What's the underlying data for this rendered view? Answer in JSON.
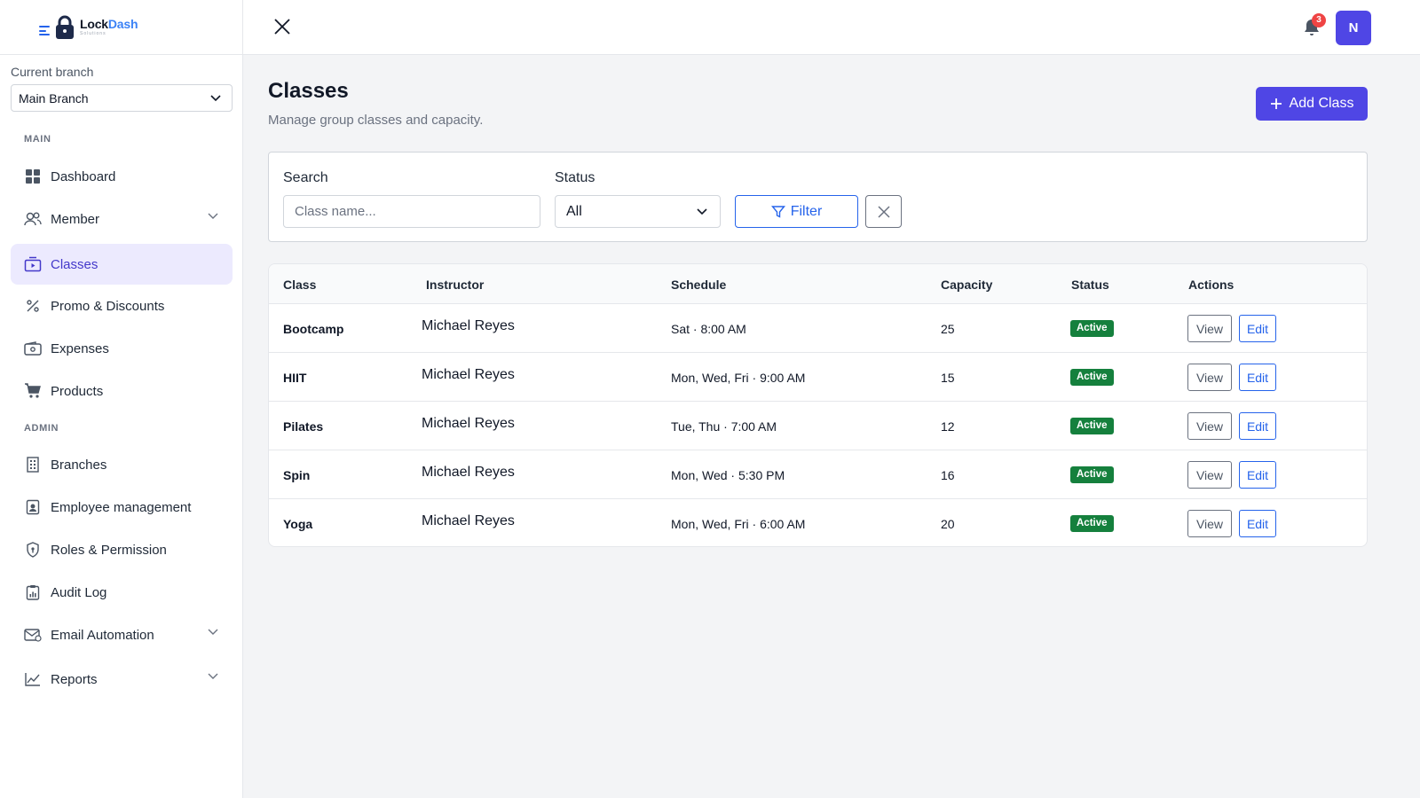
{
  "brand": {
    "name_main": "Lock",
    "name_accent": "Dash",
    "subtitle": "Solutions"
  },
  "sidebar": {
    "branch_label": "Current branch",
    "branch_value": "Main Branch",
    "sections": {
      "main": "MAIN",
      "admin": "ADMIN"
    },
    "items": [
      {
        "label": "Dashboard",
        "icon": "grid-icon"
      },
      {
        "label": "Member",
        "icon": "users-icon",
        "has_submenu": true
      },
      {
        "label": "Classes",
        "icon": "classes-icon",
        "active": true
      },
      {
        "label": "Promo & Discounts",
        "icon": "percent-icon"
      },
      {
        "label": "Expenses",
        "icon": "wallet-icon"
      },
      {
        "label": "Products",
        "icon": "cart-icon"
      },
      {
        "label": "Branches",
        "icon": "building-icon"
      },
      {
        "label": "Employee management",
        "icon": "badge-icon"
      },
      {
        "label": "Roles & Permission",
        "icon": "shield-icon"
      },
      {
        "label": "Audit Log",
        "icon": "clipboard-chart-icon"
      },
      {
        "label": "Email Automation",
        "icon": "mail-icon",
        "has_submenu": true
      },
      {
        "label": "Reports",
        "icon": "line-chart-icon",
        "has_submenu": true
      }
    ]
  },
  "topbar": {
    "notification_count": "3",
    "avatar_initial": "N"
  },
  "page": {
    "title": "Classes",
    "subtitle": "Manage group classes and capacity.",
    "add_button": "Add Class"
  },
  "filters": {
    "search_label": "Search",
    "search_placeholder": "Class name...",
    "status_label": "Status",
    "status_value": "All",
    "filter_button": "Filter"
  },
  "table": {
    "headers": [
      "Class",
      "Instructor",
      "Schedule",
      "Capacity",
      "Status",
      "Actions"
    ],
    "view_label": "View",
    "edit_label": "Edit",
    "rows": [
      {
        "class": "Bootcamp",
        "instructor": "Michael Reyes",
        "schedule": "Sat · 8:00 AM",
        "capacity": "25",
        "status": "Active"
      },
      {
        "class": "HIIT",
        "instructor": "Michael Reyes",
        "schedule": "Mon, Wed, Fri · 9:00 AM",
        "capacity": "15",
        "status": "Active"
      },
      {
        "class": "Pilates",
        "instructor": "Michael Reyes",
        "schedule": "Tue, Thu · 7:00 AM",
        "capacity": "12",
        "status": "Active"
      },
      {
        "class": "Spin",
        "instructor": "Michael Reyes",
        "schedule": "Mon, Wed · 5:30 PM",
        "capacity": "16",
        "status": "Active"
      },
      {
        "class": "Yoga",
        "instructor": "Michael Reyes",
        "schedule": "Mon, Wed, Fri · 6:00 AM",
        "capacity": "20",
        "status": "Active"
      }
    ]
  },
  "colors": {
    "primary": "#4f46e5",
    "link": "#2563eb",
    "success": "#15803d",
    "danger": "#ef4444"
  }
}
